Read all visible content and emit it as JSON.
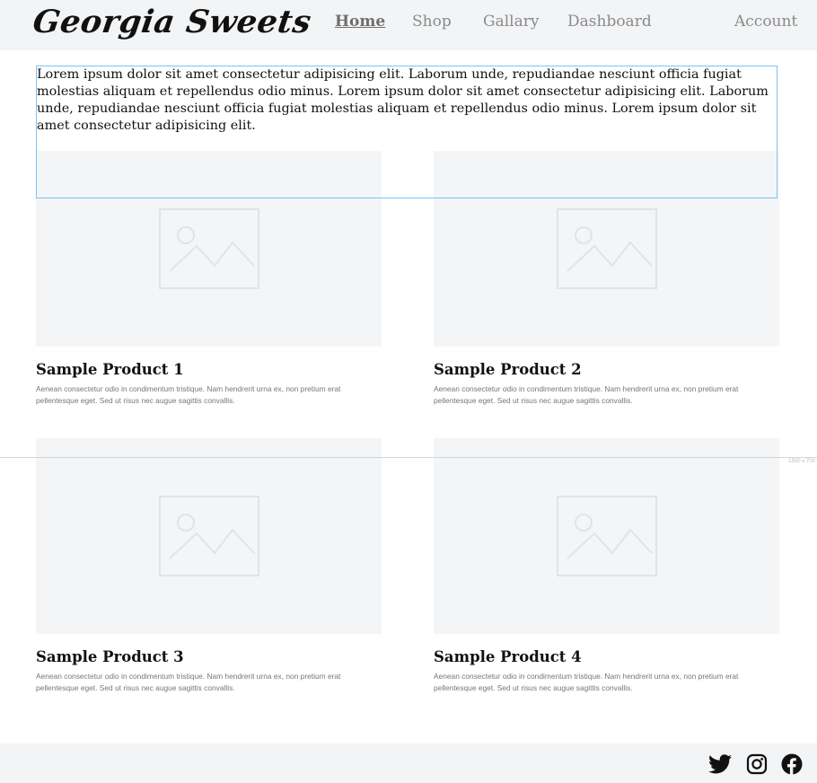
{
  "header": {
    "logo": "Georgia Sweets",
    "nav": [
      "Home",
      "Shop",
      "Gallary",
      "Dashboard"
    ],
    "account": "Account"
  },
  "intro": {
    "text": "Lorem ipsum dolor sit amet consectetur adipisicing elit. Laborum unde, repudiandae nesciunt officia fugiat molestias aliquam et repellendus odio minus. Lorem ipsum dolor sit amet consectetur adipisicing elit. Laborum unde, repudiandae nesciunt officia fugiat molestias aliquam et repellendus odio minus. Lorem ipsum dolor sit amet consectetur adipisicing elit."
  },
  "products": [
    {
      "title": "Sample Product 1",
      "description": "Aenean consectetur odio in condimentum tristique. Nam hendrerit urna ex, non pretium erat pellentesque eget. Sed ut risus nec augue sagittis convallis."
    },
    {
      "title": "Sample Product 2",
      "description": "Aenean consectetur odio in condimentum tristique. Nam hendrerit urna ex, non pretium erat pellentesque eget. Sed ut risus nec augue sagittis convallis."
    },
    {
      "title": "Sample Product 3",
      "description": "Aenean consectetur odio in condimentum tristique. Nam hendrerit urna ex, non pretium erat pellentesque eget. Sed ut risus nec augue sagittis convallis."
    },
    {
      "title": "Sample Product 4",
      "description": "Aenean consectetur odio in condimentum tristique. Nam hendrerit urna ex, non pretium erat pellentesque eget. Sed ut risus nec augue sagittis convallis."
    }
  ],
  "viewport_label": "1500 x 700",
  "footer": {
    "icons": [
      "twitter-icon",
      "instagram-icon",
      "facebook-icon"
    ]
  },
  "colors": {
    "header_bg": "#f3f4f6",
    "placeholder_bg": "#f4f5f7",
    "selection_outline": "#7cc3ee"
  }
}
